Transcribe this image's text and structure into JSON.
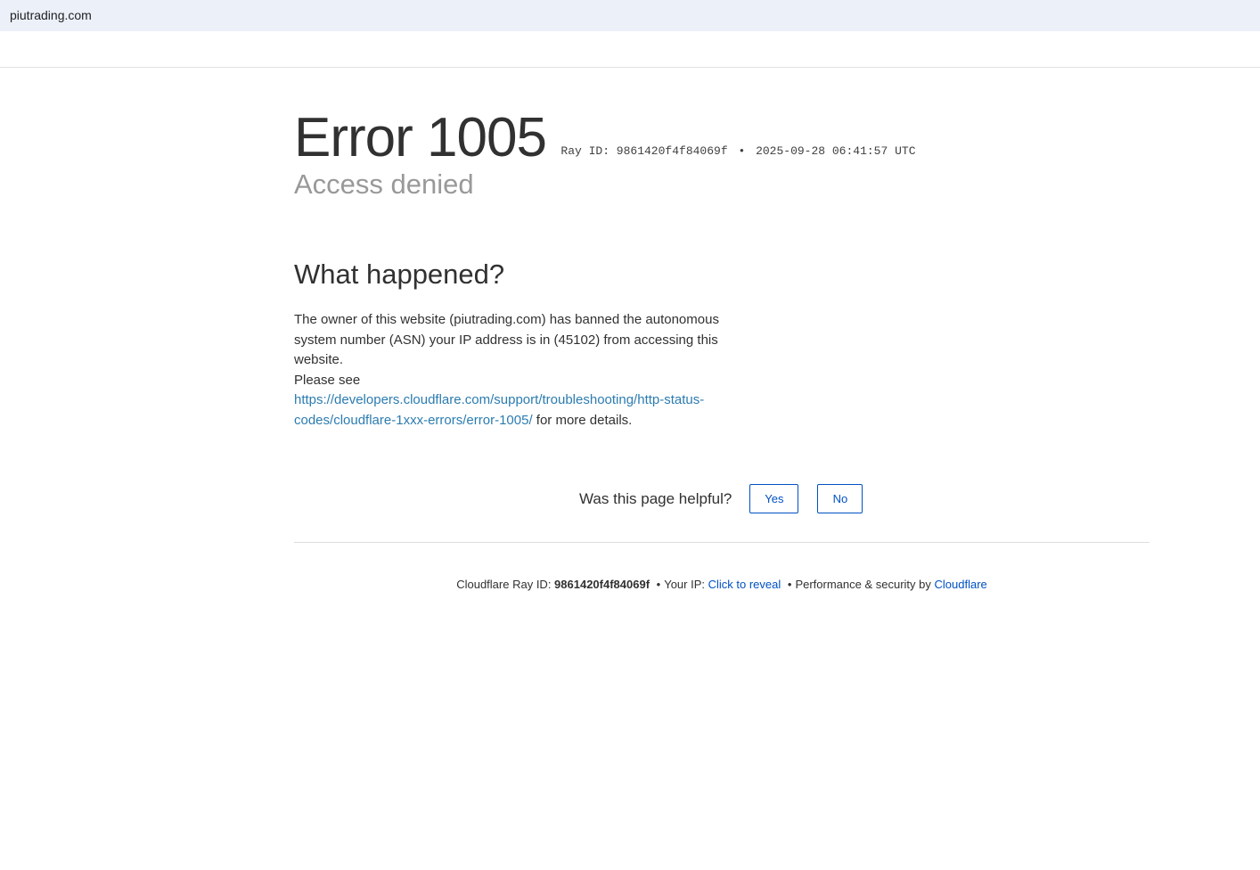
{
  "browser": {
    "address": "piutrading.com"
  },
  "error": {
    "title": "Error 1005",
    "ray_label": "Ray ID: 9861420f4f84069f",
    "separator": "•",
    "timestamp": "2025-09-28 06:41:57 UTC",
    "subtitle": "Access denied"
  },
  "what_happened": {
    "heading": "What happened?",
    "line1": "The owner of this website (piutrading.com) has banned the autonomous system number (ASN) your IP address is in (45102) from accessing this website.",
    "please_see": "Please see",
    "link": "https://developers.cloudflare.com/support/troubleshooting/http-status-codes/cloudflare-1xxx-errors/error-1005/",
    "suffix": " for more details."
  },
  "feedback": {
    "question": "Was this page helpful?",
    "yes": "Yes",
    "no": "No"
  },
  "footer": {
    "ray_prefix": "Cloudflare Ray ID: ",
    "ray_id": "9861420f4f84069f",
    "sep1": "•",
    "ip_label": "Your IP: ",
    "ip_link": "Click to reveal",
    "sep2": "•",
    "perf_text": "Performance & security by ",
    "cf_link": "Cloudflare"
  }
}
